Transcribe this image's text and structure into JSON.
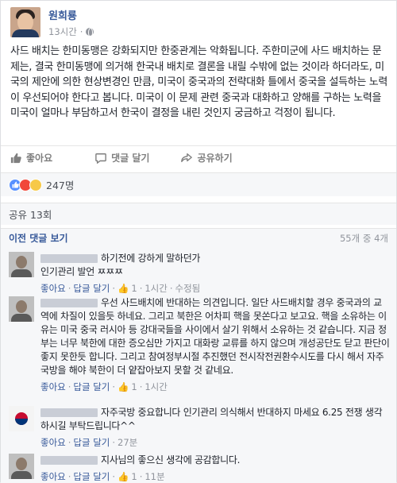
{
  "post": {
    "author": "원희룡",
    "time": "13시간",
    "text": "사드 배치는 한미동맹은 강화되지만 한중관계는 악화됩니다. 주한미군에 사드 배치하는 문제는, 결국 한미동맹에 의거해 한국내 배치로 결론을 내릴 수밖에 없는 것이라 하더라도, 미국의 제안에 의한 현상변경인 만큼, 미국이 중국과의 전략대화 틀에서 중국을 설득하는 노력이 우선되어야 한다고 봅니다. 미국이 이 문제 관련 중국과 대화하고 양해를 구하는 노력을 미국이 얼마나 부담하고서 한국이 결정을 내린 것인지 궁금하고 걱정이 됩니다."
  },
  "actions": {
    "like": "좋아요",
    "comment": "댓글 달기",
    "share": "공유하기"
  },
  "reactions": {
    "count": "247명"
  },
  "shares": {
    "label": "공유 13회"
  },
  "comments_header": {
    "prev": "이전 댓글 보기",
    "count": "55개 중 4개"
  },
  "comments": [
    {
      "text": "하기전에 강하게 말하던가\n인기관리 발언 ㅉㅉㅉ",
      "like": "좋아요",
      "reply": "답글 달기",
      "likes": "1",
      "time": "1시간",
      "edited": "수정됨"
    },
    {
      "text": "우선 사드배치에 반대하는 의견입니다. 일단 사드배치할 경우 중국과의 교역에 차질이 있을듯 하네요. 그리고 북한은 어차피 핵을 못쏜다고 보고요. 핵을 소유하는 이유는 미국 중국 러시아 등 강대국들을 사이에서 살기 위해서 소유하는 것 같습니다. 지금 정부는 너무 북한에 대한 증오심만 가지고 대화랑 교류를 하지 않으며 개성공단도 닫고 판단이 좋지 못한듯 합니다. 그리고 참여정부시절 추진했던 전시작전권환수시도를 다시 해서 자주국방을 해야 북한이 더 얕잡아보지 못할 것 같네요.",
      "like": "좋아요",
      "reply": "답글 달기",
      "likes": "1",
      "time": "1시간"
    },
    {
      "text": "자주국방 중요합니다 인기관리 의식해서 반대하지 마세요 6.25 전쟁 생각하시길 부탁드립니다^^",
      "like": "좋아요",
      "reply": "답글 달기",
      "time": "27분"
    },
    {
      "text": "지사님의 좋으신 생각에 공감합니다.",
      "like": "좋아요",
      "reply": "답글 달기",
      "likes": "1",
      "time": "11분"
    }
  ]
}
